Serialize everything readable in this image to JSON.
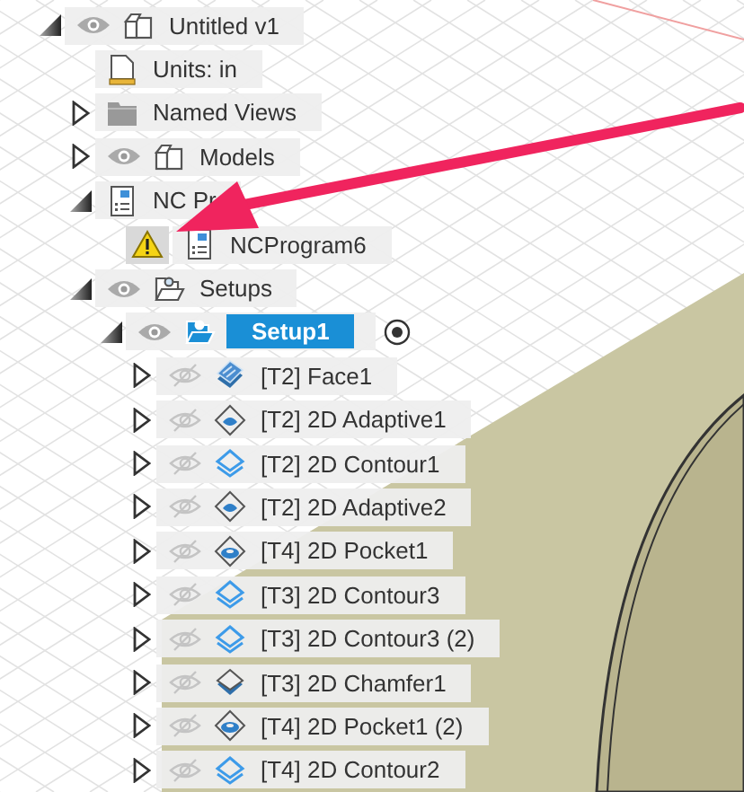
{
  "annotation": {
    "kind": "arrow"
  },
  "tree": [
    {
      "label": "Untitled v1",
      "kind": "design",
      "expanded": true,
      "visible": true,
      "selected": false,
      "children": [
        {
          "label": "Units: in",
          "kind": "units",
          "selected": false
        },
        {
          "label": "Named Views",
          "kind": "folder",
          "expanded": false,
          "selected": false
        },
        {
          "label": "Models",
          "kind": "component",
          "expanded": false,
          "visible": true,
          "selected": false
        },
        {
          "label": "NC Pr",
          "kind": "ncprogram",
          "expanded": true,
          "selected": false,
          "children": [
            {
              "label": "NCProgram6",
              "kind": "ncprogram",
              "warning": true,
              "selected": false
            }
          ]
        },
        {
          "label": "Setups",
          "kind": "setups",
          "expanded": true,
          "visible": true,
          "selected": false,
          "children": [
            {
              "label": "Setup1",
              "kind": "setup",
              "expanded": true,
              "visible": true,
              "selected": true,
              "active": true,
              "children": [
                {
                  "label": "[T2] Face1",
                  "kind": "face",
                  "expanded": false,
                  "visible": false,
                  "selected": false
                },
                {
                  "label": "[T2] 2D Adaptive1",
                  "kind": "adaptive",
                  "expanded": false,
                  "visible": false,
                  "selected": false
                },
                {
                  "label": "[T2] 2D Contour1",
                  "kind": "contour",
                  "expanded": false,
                  "visible": false,
                  "selected": false
                },
                {
                  "label": "[T2] 2D Adaptive2",
                  "kind": "adaptive",
                  "expanded": false,
                  "visible": false,
                  "selected": false
                },
                {
                  "label": "[T4] 2D Pocket1",
                  "kind": "pocket",
                  "expanded": false,
                  "visible": false,
                  "selected": false
                },
                {
                  "label": "[T3] 2D Contour3",
                  "kind": "contour",
                  "expanded": false,
                  "visible": false,
                  "selected": false
                },
                {
                  "label": "[T3] 2D Contour3 (2)",
                  "kind": "contour",
                  "expanded": false,
                  "visible": false,
                  "selected": false
                },
                {
                  "label": "[T3] 2D Chamfer1",
                  "kind": "chamfer",
                  "expanded": false,
                  "visible": false,
                  "selected": false
                },
                {
                  "label": "[T4] 2D Pocket1 (2)",
                  "kind": "pocket",
                  "expanded": false,
                  "visible": false,
                  "selected": false
                },
                {
                  "label": "[T4] 2D Contour2",
                  "kind": "contour",
                  "expanded": false,
                  "visible": false,
                  "selected": false
                }
              ]
            }
          ]
        }
      ]
    }
  ]
}
